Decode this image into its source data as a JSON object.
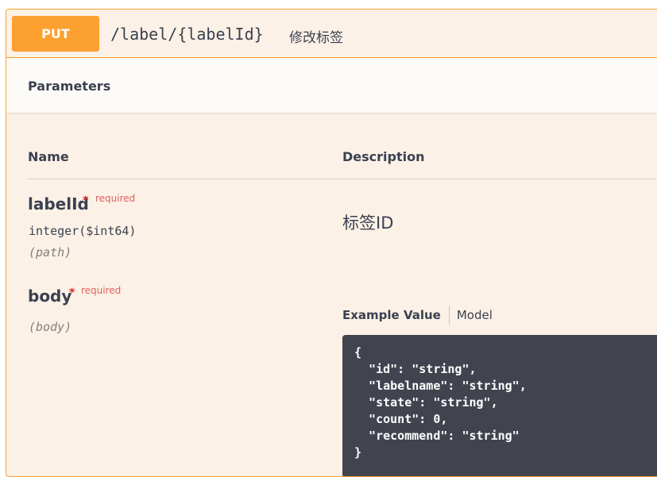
{
  "operation": {
    "method": "PUT",
    "path": "/label/{labelId}",
    "summary": "修改标签"
  },
  "parameters": {
    "title": "Parameters",
    "columns": {
      "name": "Name",
      "description": "Description"
    },
    "items": [
      {
        "name": "labelId",
        "required_star": "*",
        "required_label": "required",
        "type": "integer($int64)",
        "in": "(path)",
        "description": "标签ID"
      },
      {
        "name": "body",
        "required_star": "*",
        "required_label": "required",
        "in": "(body)"
      }
    ]
  },
  "body_example": {
    "tabs": [
      "Example Value",
      "Model"
    ],
    "code": "{\n  \"id\": \"string\",\n  \"labelname\": \"string\",\n  \"state\": \"string\",\n  \"count\": 0,\n  \"recommend\": \"string\"\n}"
  },
  "colors": {
    "put_accent": "#fca130",
    "panel_bg": "#fcf1e6",
    "code_bg": "#41444e",
    "required_red": "#e02020"
  }
}
